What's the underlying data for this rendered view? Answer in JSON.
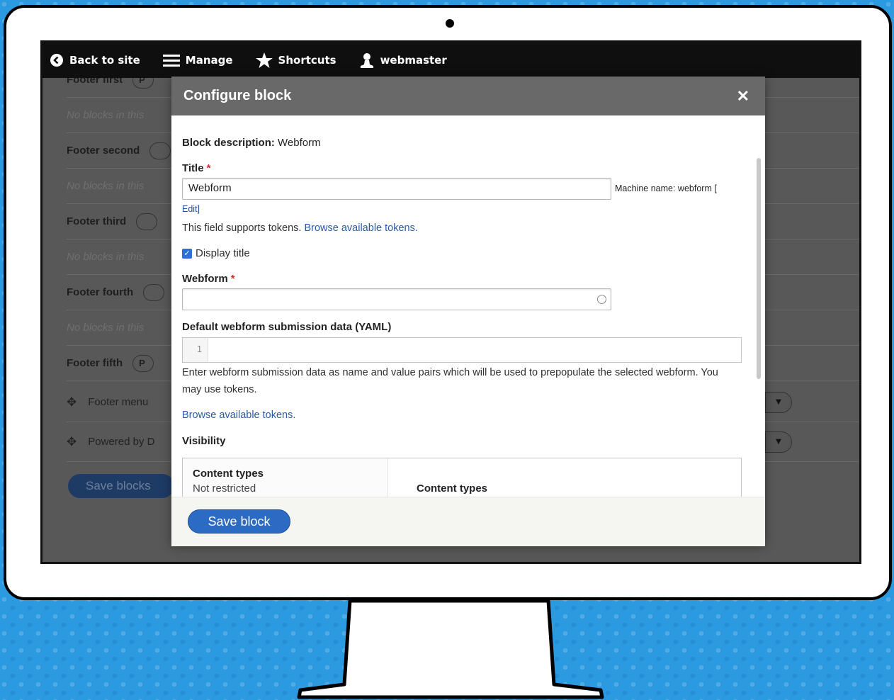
{
  "toolbar": {
    "back_label": "Back to site",
    "manage_label": "Manage",
    "shortcuts_label": "Shortcuts",
    "user_label": "webmaster"
  },
  "background": {
    "rows": [
      {
        "label": "Footer first",
        "pill": "P"
      },
      {
        "label": "No blocks in this"
      },
      {
        "label": "Footer second",
        "pill": ""
      },
      {
        "label": "No blocks in this"
      },
      {
        "label": "Footer third",
        "pill": ""
      },
      {
        "label": "No blocks in this"
      },
      {
        "label": "Footer fourth",
        "pill": ""
      },
      {
        "label": "No blocks in this"
      },
      {
        "label": "Footer fifth",
        "pill": "P"
      }
    ],
    "items": [
      {
        "label": "Footer menu"
      },
      {
        "label": "Powered by D"
      }
    ],
    "save_label": "Save blocks"
  },
  "modal": {
    "title": "Configure block",
    "close_symbol": "✕",
    "description_label": "Block description:",
    "description_value": " Webform",
    "title_label": "Title",
    "required_mark": "*",
    "title_value": "Webform",
    "machine_name": "Machine name: webform [",
    "edit_link": "Edit]",
    "token_help": "This field supports tokens.",
    "browse_tokens": "Browse available tokens.",
    "display_title_label": "Display title",
    "webform_label": "Webform",
    "webform_value": "",
    "yaml_label": "Default webform submission data (YAML)",
    "yaml_line_number": "1",
    "yaml_help": "Enter webform submission data as name and value pairs which will be used to prepopulate the selected webform. You may use tokens.",
    "browse_tokens_2": "Browse available tokens.",
    "visibility_label": "Visibility",
    "vis_tab_title": "Content types",
    "vis_tab_sub": "Not restricted",
    "vis_pane_title": "Content types",
    "save_label": "Save block"
  }
}
